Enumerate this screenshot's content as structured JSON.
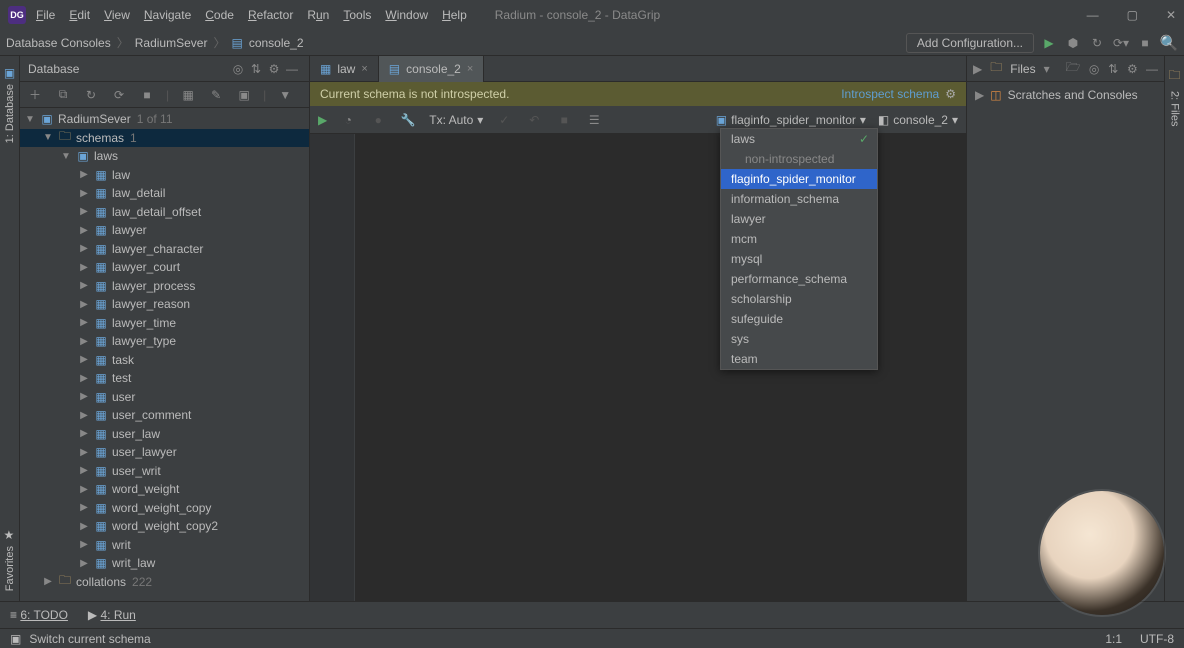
{
  "app_title": "Radium - console_2 - DataGrip",
  "logo_text": "DG",
  "menu": [
    "File",
    "Edit",
    "View",
    "Navigate",
    "Code",
    "Refactor",
    "Run",
    "Tools",
    "Window",
    "Help"
  ],
  "breadcrumbs": [
    "Database Consoles",
    "RadiumSever",
    "console_2"
  ],
  "add_config": "Add Configuration...",
  "database_panel_title": "Database",
  "left_rail": {
    "label": "1: Database",
    "favorites": "Favorites"
  },
  "right_rail": {
    "label": "2: Files"
  },
  "tabs": [
    {
      "label": "law",
      "active": false
    },
    {
      "label": "console_2",
      "active": true
    }
  ],
  "banner": {
    "msg": "Current schema is not introspected.",
    "link": "Introspect schema"
  },
  "editor_toolbar": {
    "tx": "Tx: Auto",
    "schema": "flaginfo_spider_monitor",
    "console": "console_2"
  },
  "right_panel": {
    "files": "Files",
    "tree": "Scratches and Consoles"
  },
  "tree": {
    "server": "RadiumSever",
    "server_count": "1 of 11",
    "schemas_label": "schemas",
    "schemas_count": "1",
    "schema": "laws",
    "tables": [
      "law",
      "law_detail",
      "law_detail_offset",
      "lawyer",
      "lawyer_character",
      "lawyer_court",
      "lawyer_process",
      "lawyer_reason",
      "lawyer_time",
      "lawyer_type",
      "task",
      "test",
      "user",
      "user_comment",
      "user_law",
      "user_lawyer",
      "user_writ",
      "word_weight",
      "word_weight_copy",
      "word_weight_copy2",
      "writ",
      "writ_law"
    ],
    "collations_label": "collations",
    "collations_count": "222"
  },
  "popup": {
    "top": "laws",
    "header": "non-introspected",
    "items": [
      "flaginfo_spider_monitor",
      "information_schema",
      "lawyer",
      "mcm",
      "mysql",
      "performance_schema",
      "scholarship",
      "sufeguide",
      "sys",
      "team"
    ],
    "selected": "flaginfo_spider_monitor"
  },
  "status": {
    "todo": "6: TODO",
    "run": "4: Run",
    "bottom": "Switch current schema",
    "pos": "1:1",
    "enc": "UTF-8"
  }
}
